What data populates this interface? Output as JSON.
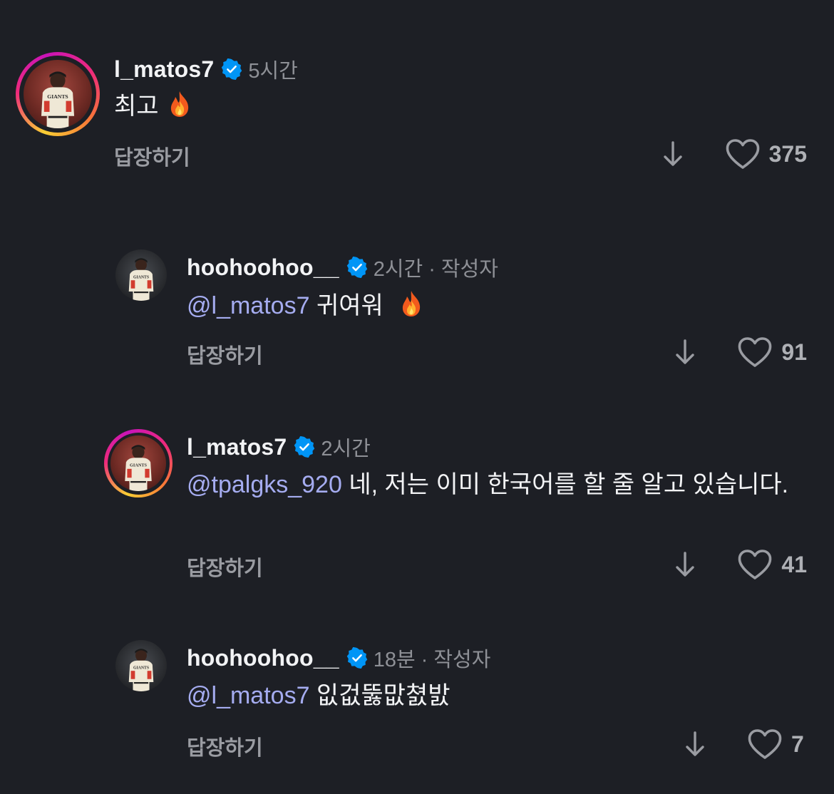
{
  "comments": [
    {
      "username": "l_matos7",
      "time": "5시간",
      "author_tag": "",
      "mention": "",
      "text": "최고",
      "emoji": "fire",
      "reply_label": "답장하기",
      "likes": "375"
    },
    {
      "username": "hoohoohoo__",
      "time": "2시간",
      "author_tag": "· 작성자",
      "mention": "@l_matos7",
      "text": "귀여워",
      "emoji": "fire",
      "reply_label": "답장하기",
      "likes": "91"
    },
    {
      "username": "l_matos7",
      "time": "2시간",
      "author_tag": "",
      "mention": "@tpalgks_920",
      "text": "네, 저는 이미 한국어를 할 줄 알고 있습니다.",
      "emoji": "",
      "reply_label": "답장하기",
      "likes": "41"
    },
    {
      "username": "hoohoohoo__",
      "time": "18분",
      "author_tag": "· 작성자",
      "mention": "@l_matos7",
      "text": "잆겂뚫맚쳜밠",
      "emoji": "",
      "reply_label": "답장하기",
      "likes": "7"
    }
  ],
  "colors": {
    "background": "#1d1f25",
    "mention": "#a5acf0",
    "verified": "#0095f6",
    "muted": "#8e9096"
  }
}
